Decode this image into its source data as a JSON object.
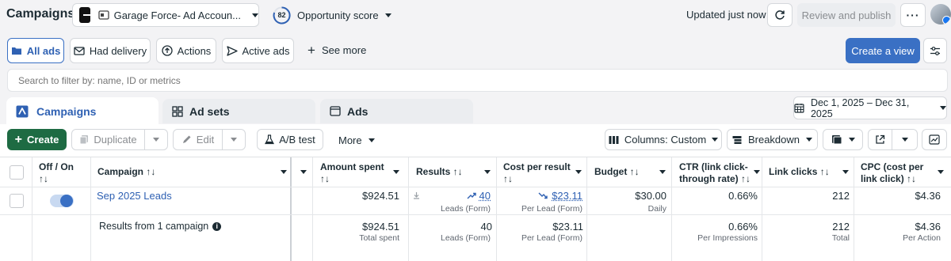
{
  "topbar": {
    "title": "Campaigns",
    "account_name": "Garage Force- Ad Accoun...",
    "opportunity_score": "82",
    "opportunity_label": "Opportunity score",
    "updated_text": "Updated just now",
    "review_publish": "Review and publish"
  },
  "filters": {
    "all_ads": "All ads",
    "had_delivery": "Had delivery",
    "actions": "Actions",
    "active_ads": "Active ads",
    "see_more": "See more",
    "create_view": "Create a view",
    "search_placeholder": "Search to filter by: name, ID or metrics"
  },
  "tabs": {
    "campaigns": "Campaigns",
    "ad_sets": "Ad sets",
    "ads": "Ads",
    "date_range": "Dec 1, 2025 – Dec 31, 2025"
  },
  "toolbar": {
    "create": "Create",
    "duplicate": "Duplicate",
    "edit": "Edit",
    "ab_test": "A/B test",
    "more": "More",
    "columns": "Columns: Custom",
    "breakdown": "Breakdown"
  },
  "table": {
    "headers": {
      "off_on": "Off / On",
      "sort_glyph": "↑↓",
      "campaign": "Campaign ↑↓",
      "amount_spent": "Amount spent",
      "results": "Results ↑↓",
      "cost_per_result": "Cost per result",
      "budget": "Budget ↑↓",
      "ctr": "CTR (link click-through rate) ↑↓",
      "ctr_line1": "CTR (link click-",
      "ctr_line2": "through rate) ↑↓",
      "link_clicks": "Link clicks ↑↓",
      "cpc_line1": "CPC (cost per",
      "cpc_line2": "link click) ↑↓"
    },
    "row": {
      "campaign_name": "Sep 2025 Leads",
      "toggle_on": true,
      "amount_spent": "$924.51",
      "results": "40",
      "results_sub": "Leads (Form)",
      "cost_per_result": "$23.11",
      "cost_sub": "Per Lead (Form)",
      "budget": "$30.00",
      "budget_sub": "Daily",
      "ctr": "0.66%",
      "link_clicks": "212",
      "cpc": "$4.36"
    },
    "summary": {
      "label": "Results from 1 campaign",
      "amount_spent": "$924.51",
      "amount_sub": "Total spent",
      "results": "40",
      "results_sub": "Leads (Form)",
      "cost_per_result": "$23.11",
      "cost_sub": "Per Lead (Form)",
      "ctr": "0.66%",
      "ctr_sub": "Per Impressions",
      "link_clicks": "212",
      "link_clicks_sub": "Total",
      "cpc": "$4.36",
      "cpc_sub": "Per Action"
    }
  },
  "colors": {
    "accent": "#3a70c4",
    "create_green": "#1e6b43",
    "link_blue": "#2f61b3"
  }
}
